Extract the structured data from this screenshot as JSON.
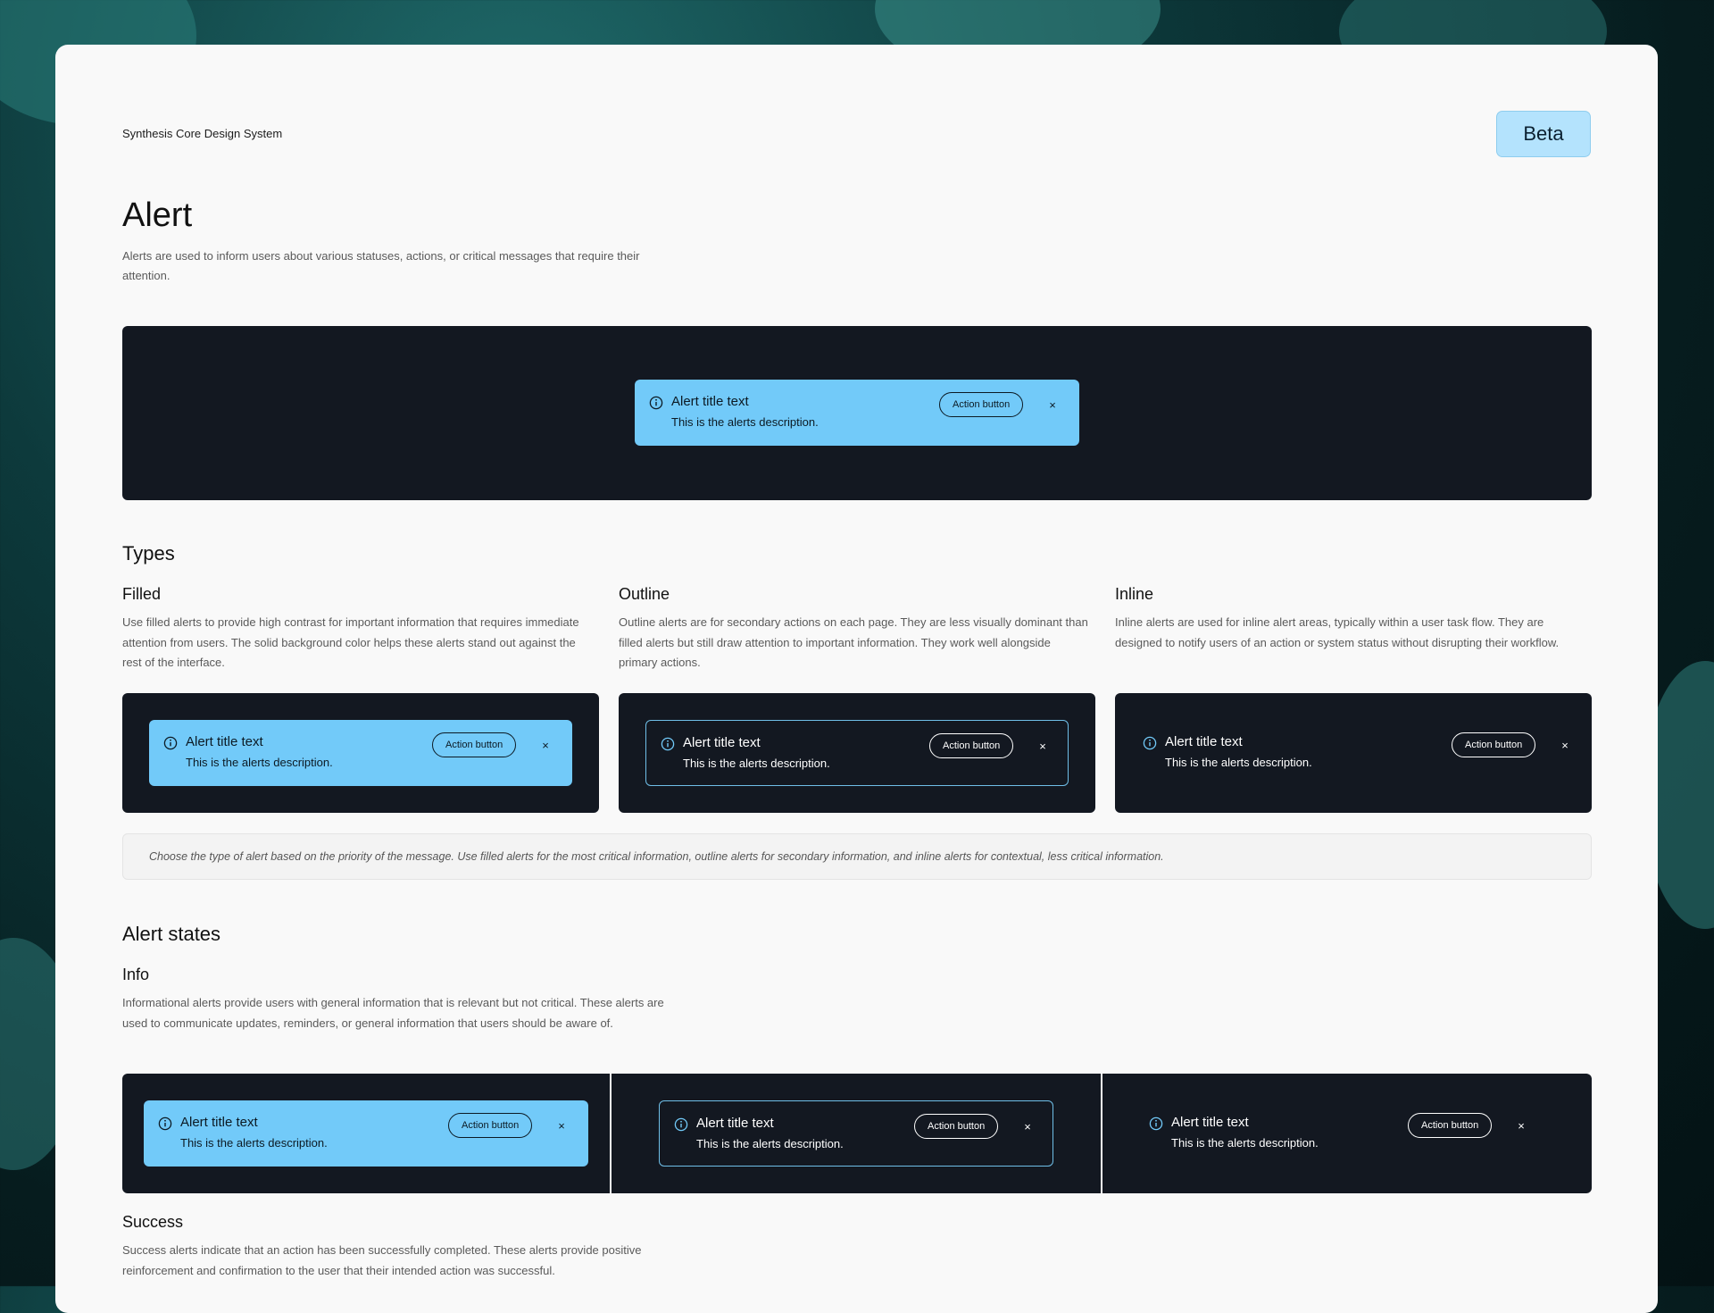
{
  "header": {
    "brand": "Synthesis Core Design System",
    "badge": "Beta"
  },
  "intro": {
    "title": "Alert",
    "description": "Alerts are used to inform users about various statuses, actions, or critical messages that require their attention."
  },
  "alert_sample": {
    "title": "Alert title text",
    "description": "This is the alerts description.",
    "action_label": "Action button",
    "close_glyph": "×",
    "icon": "info-circle-icon"
  },
  "types": {
    "heading": "Types",
    "items": [
      {
        "name": "Filled",
        "description": "Use filled alerts to provide high contrast for important information that requires immediate attention from users. The solid background color helps these alerts stand out against the rest of the interface."
      },
      {
        "name": "Outline",
        "description": "Outline alerts are for secondary actions on each page. They are less visually dominant than filled alerts but still draw attention to important information. They work well alongside primary actions."
      },
      {
        "name": "Inline",
        "description": "Inline alerts are used for inline alert areas, typically within a user task flow. They are designed to notify users of an action or system status without disrupting their workflow."
      }
    ],
    "note": "Choose the type of alert based on the priority of the message. Use filled alerts for the most critical information, outline alerts for secondary information, and inline alerts for contextual, less critical information."
  },
  "states": {
    "heading": "Alert states",
    "info": {
      "name": "Info",
      "description": "Informational alerts provide users with general information that is relevant but not critical. These alerts are used to communicate updates, reminders, or general information that users should be aware of."
    },
    "success": {
      "name": "Success",
      "description": "Success alerts indicate that an action has been successfully completed. These alerts provide positive reinforcement and confirmation to the user that their intended action was successful."
    }
  },
  "colors": {
    "stage_bg": "#131821",
    "alert_info_fill": "#72caf9",
    "alert_info_border": "#6fbfe8",
    "badge_bg": "#b4e3fd",
    "page_bg": "#f9f9f9"
  }
}
